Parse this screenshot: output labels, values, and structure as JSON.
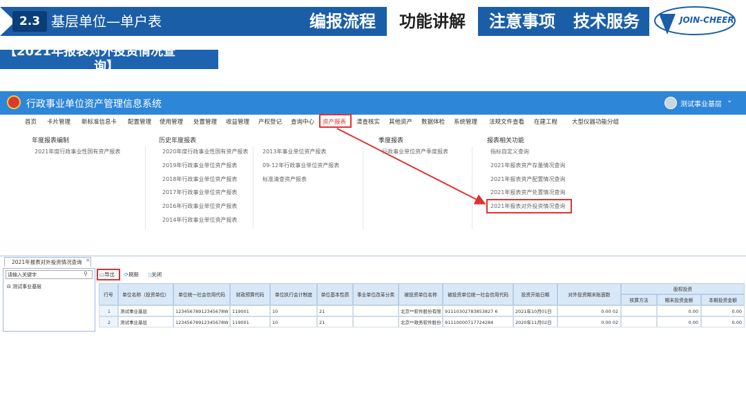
{
  "slide_header": {
    "section_num": "2.3",
    "section_title": "基层单位—单户表",
    "tabs": [
      "编报流程",
      "功能讲解",
      "注意事项",
      "技术服务"
    ],
    "active_tab": "功能讲解",
    "logo_text": "JOIN-CHEER"
  },
  "caption": {
    "line1": "【2021年报表对外投资情况查",
    "line2": "询】"
  },
  "app": {
    "title": "行政事业单位资产管理信息系统",
    "user": "测试事业基层",
    "menu": [
      "首页",
      "卡片管理",
      "新标准信息卡",
      "配置管理",
      "使用管理",
      "处置管理",
      "收益管理",
      "产权登记",
      "查询中心",
      "资产报表",
      "清查核实",
      "其他资产",
      "数据体检",
      "系统管理",
      "法规文件查看",
      "在建工程",
      "大型仪器功能分组"
    ],
    "menu_active": "资产报表"
  },
  "dropdown": {
    "annual": {
      "title": "年度报表编制",
      "links": [
        "2021年度行政事业性国有资产报表"
      ]
    },
    "history": {
      "title": "历史年度报表",
      "col1": [
        "2020年度行政事业性国有资产报表",
        "2019年行政事业单位资产报表",
        "2018年行政事业单位资产报表",
        "2017年行政事业单位资产报表",
        "2016年行政事业单位资产报表",
        "2014年行政事业单位资产报表"
      ],
      "col2": [
        "2013年事业单位资产报表",
        "09-12年行政事业单位资产报表",
        "标准清查资产报表"
      ]
    },
    "quarter": {
      "title": "季度报表",
      "links": [
        "行政事业单位资产季度报表"
      ]
    },
    "related": {
      "title": "报表相关功能",
      "links": [
        "指标自定义查询",
        "2021年报表资产存量情况查询",
        "2021年报表资产配置情况查询",
        "2021年报表资产处置情况查询",
        "2021年报表对外投资情况查询"
      ]
    }
  },
  "panel": {
    "tab_label": "2021年报表对外投资情况查询",
    "search_placeholder": "请输入关键字",
    "tree_item": "测试事业基层",
    "toolbar": {
      "export": "导出",
      "refresh": "刷新",
      "close": "关闭"
    }
  },
  "grid": {
    "headers": [
      "行号",
      "单位名称（投资单位）",
      "单位统一社会信用代码",
      "财政预算代码",
      "单位执行会计制度",
      "单位基本性质",
      "事业单位改革分类",
      "被投资单位名称",
      "被投资单位统一社会信用代码",
      "投资开始日期",
      "对外投资期末账面数",
      "核算方法",
      "期末投资金额",
      "本期投资金额"
    ],
    "group_header": "股权投资",
    "rows": [
      [
        "1",
        "测试事业基层",
        "12345678912345678W",
        "119001",
        "10",
        "21",
        "",
        "北京**软件股份有限",
        "91110302783853827 6",
        "2021年10月01日",
        "0.00 02",
        "",
        "0.00",
        "0.00"
      ],
      [
        "2",
        "测试事业基层",
        "12345678912345678W",
        "119001",
        "10",
        "21",
        "",
        "北京**政务软件股份",
        "91110000717724284",
        "2020年11月02日",
        "0.00 02",
        "",
        "0.00",
        "0.00"
      ]
    ]
  }
}
